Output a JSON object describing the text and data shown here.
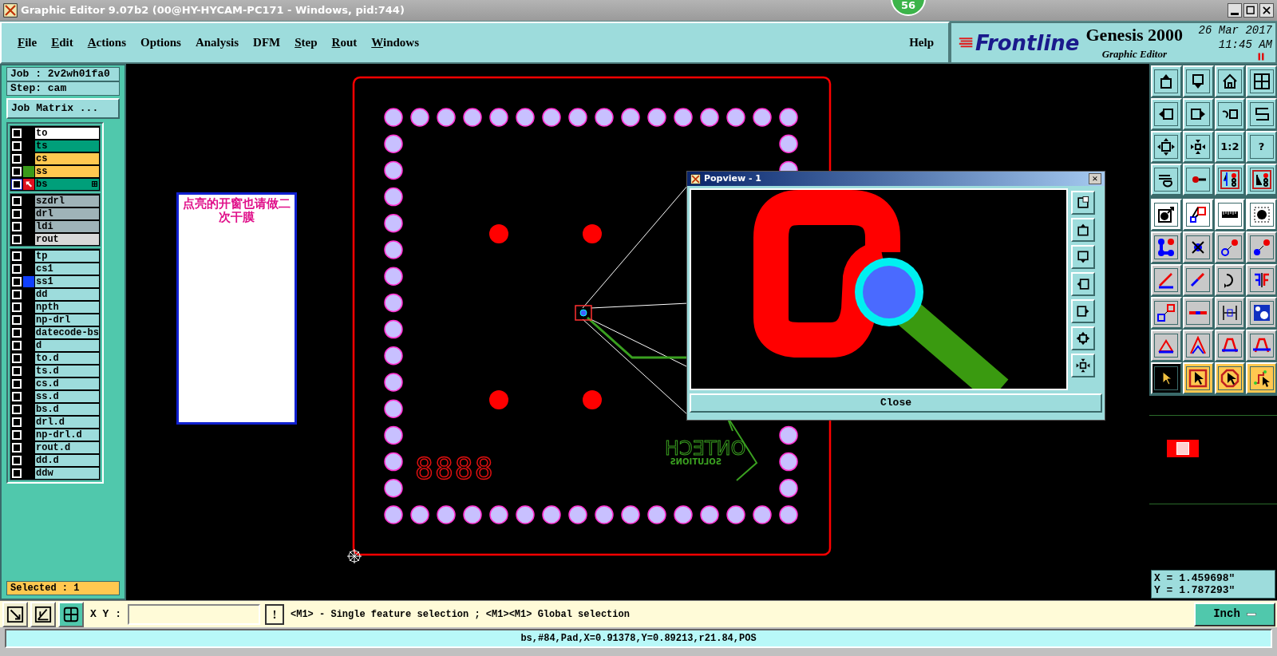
{
  "window": {
    "title": "Graphic Editor 9.07b2 (00@HY-HYCAM-PC171 - Windows, pid:744)",
    "badge": "56"
  },
  "menu": [
    {
      "label": "File",
      "mnemonic": true
    },
    {
      "label": "Edit",
      "mnemonic": true
    },
    {
      "label": "Actions",
      "mnemonic": true
    },
    {
      "label": "Options",
      "mnemonic": false
    },
    {
      "label": "Analysis",
      "mnemonic": false
    },
    {
      "label": "DFM",
      "mnemonic": false
    },
    {
      "label": "Step",
      "mnemonic": true
    },
    {
      "label": "Rout",
      "mnemonic": true
    },
    {
      "label": "Windows",
      "mnemonic": true
    }
  ],
  "help": "Help",
  "brand": {
    "logo": "Frontline",
    "product": "Genesis 2000",
    "subtitle": "Graphic Editor",
    "date": "26 Mar 2017",
    "time": "11:45 AM"
  },
  "job": "Job : 2v2wh01fa0",
  "step": "Step: cam",
  "job_matrix": "Job Matrix ...",
  "layer_groups": [
    {
      "layers": [
        {
          "name": "to",
          "color": "#ffffff",
          "checked": false,
          "work": false
        },
        {
          "name": "ts",
          "color": "#009f7a",
          "checked": false,
          "work": false
        },
        {
          "name": "cs",
          "color": "#ffc850",
          "checked": false,
          "work": false
        },
        {
          "name": "ss",
          "color": "#ffc850",
          "display": {
            "color": "#3a9a1a"
          },
          "checked": false,
          "work": false
        },
        {
          "name": "bs",
          "color": "#009f7a",
          "display": {
            "color": "#e01020"
          },
          "checked": false,
          "work": true
        }
      ]
    },
    {
      "layers": [
        {
          "name": "szdrl",
          "color": "#9fb3b8",
          "checked": false,
          "work": false
        },
        {
          "name": "drl",
          "color": "#9fb3b8",
          "checked": false,
          "work": false
        },
        {
          "name": "ldi",
          "color": "#9fb3b8",
          "checked": false,
          "work": false
        },
        {
          "name": "rout",
          "color": "#d8d8d8",
          "checked": false,
          "work": false
        }
      ]
    },
    {
      "layers": [
        {
          "name": "tp",
          "color": "#9ddcdc",
          "checked": false,
          "work": false
        },
        {
          "name": "cs1",
          "color": "#9ddcdc",
          "checked": false,
          "work": false
        },
        {
          "name": "ss1",
          "color": "#9ddcdc",
          "display": {
            "color": "#1040ff"
          },
          "checked": false,
          "work": false
        },
        {
          "name": "dd",
          "color": "#9ddcdc",
          "checked": false,
          "work": false
        },
        {
          "name": "npth",
          "color": "#9ddcdc",
          "checked": false,
          "work": false
        },
        {
          "name": "np-drl",
          "color": "#9ddcdc",
          "checked": false,
          "work": false
        },
        {
          "name": "datecode-bs",
          "color": "#9ddcdc",
          "checked": false,
          "work": false
        },
        {
          "name": "d",
          "color": "#9ddcdc",
          "checked": false,
          "work": false
        },
        {
          "name": "to.d",
          "color": "#9ddcdc",
          "checked": false,
          "work": false
        },
        {
          "name": "ts.d",
          "color": "#9ddcdc",
          "checked": false,
          "work": false
        },
        {
          "name": "cs.d",
          "color": "#9ddcdc",
          "checked": false,
          "work": false
        },
        {
          "name": "ss.d",
          "color": "#9ddcdc",
          "checked": false,
          "work": false
        },
        {
          "name": "bs.d",
          "color": "#9ddcdc",
          "checked": false,
          "work": false
        },
        {
          "name": "drl.d",
          "color": "#9ddcdc",
          "checked": false,
          "work": false
        },
        {
          "name": "np-drl.d",
          "color": "#9ddcdc",
          "checked": false,
          "work": false
        },
        {
          "name": "rout.d",
          "color": "#9ddcdc",
          "checked": false,
          "work": false
        },
        {
          "name": "dd.d",
          "color": "#9ddcdc",
          "checked": false,
          "work": false
        },
        {
          "name": "ddw",
          "color": "#9ddcdc",
          "checked": false,
          "work": false
        }
      ]
    }
  ],
  "selected_count": "Selected : 1",
  "canvas": {
    "note": "点亮的开窗也请做二次干膜",
    "digits": "8888",
    "logo_lines": [
      "ONTECH",
      "SOLUTIONS"
    ]
  },
  "popview": {
    "title": "Popview - 1",
    "close_glyph": "×",
    "close_button": "Close"
  },
  "tools": [
    {
      "selected": false
    },
    {
      "selected": false
    },
    {
      "selected": false
    },
    {
      "selected": false
    },
    {
      "selected": false
    },
    {
      "selected": false
    },
    {
      "selected": false
    },
    {
      "selected": false
    },
    {
      "selected": false
    },
    {
      "selected": false
    },
    {
      "selected": false,
      "label": "1:2"
    },
    {
      "selected": false,
      "label": "?"
    },
    {
      "selected": false
    },
    {
      "selected": false
    },
    {
      "selected": false
    },
    {
      "selected": false
    },
    {
      "selected": false
    },
    {
      "selected": false
    },
    {
      "selected": false
    },
    {
      "selected": false
    },
    {
      "selected": false
    },
    {
      "selected": false
    },
    {
      "selected": false
    },
    {
      "selected": false
    },
    {
      "selected": false
    },
    {
      "selected": false
    },
    {
      "selected": false
    },
    {
      "selected": false
    },
    {
      "selected": false
    },
    {
      "selected": false
    },
    {
      "selected": false
    },
    {
      "selected": false
    },
    {
      "selected": false
    },
    {
      "selected": false
    },
    {
      "selected": false
    },
    {
      "selected": false
    },
    {
      "selected": true
    },
    {
      "selected": false
    },
    {
      "selected": false
    },
    {
      "selected": false
    }
  ],
  "coordinates": [
    "X = 1.459698\"",
    "Y = 1.787293\""
  ],
  "command": {
    "label": "X Y :",
    "alert": "!",
    "message": "<M1> - Single feature selection ; <M1><M1> Global selection",
    "units": "Inch"
  },
  "status_bar": "bs,#84,Pad,X=0.91378,Y=0.89213,r21.84,POS"
}
